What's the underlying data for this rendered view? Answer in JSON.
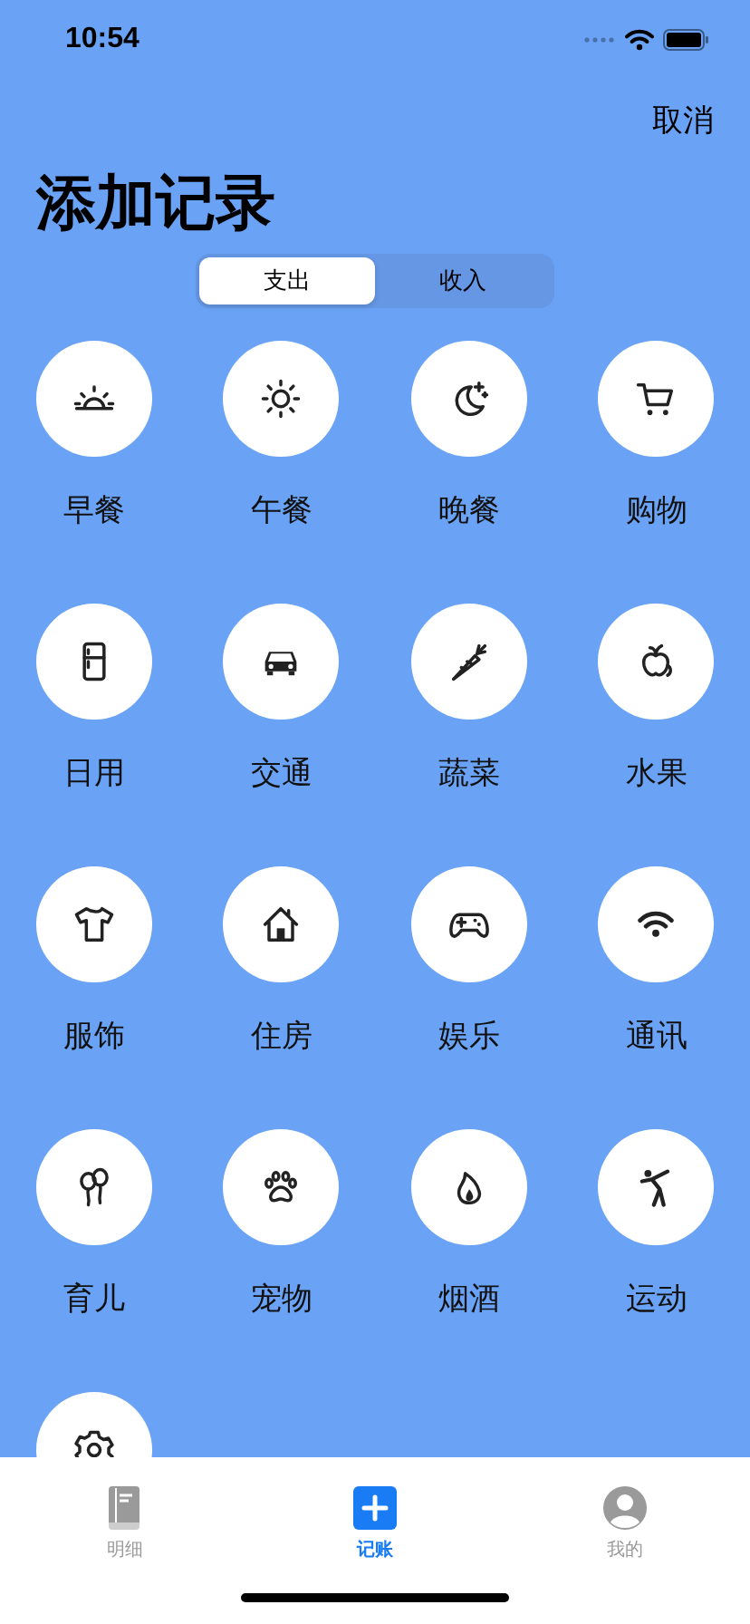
{
  "status_bar": {
    "time": "10:54"
  },
  "cancel": "取消",
  "title": "添加记录",
  "segments": [
    {
      "label": "支出",
      "selected": true
    },
    {
      "label": "收入",
      "selected": false
    }
  ],
  "categories": [
    {
      "kind": "labeled",
      "label": "早餐"
    },
    {
      "kind": "labeled",
      "label": "午餐"
    },
    {
      "kind": "labeled",
      "label": "晚餐"
    },
    {
      "kind": "labeled",
      "label": "购物"
    },
    {
      "kind": "labeled",
      "label": "日用"
    },
    {
      "kind": "labeled",
      "label": "交通"
    },
    {
      "kind": "labeled",
      "label": "蔬菜"
    },
    {
      "kind": "labeled",
      "label": "水果"
    },
    {
      "kind": "labeled",
      "label": "服饰"
    },
    {
      "kind": "labeled",
      "label": "住房"
    },
    {
      "kind": "labeled",
      "label": "娱乐"
    },
    {
      "kind": "labeled",
      "label": "通讯"
    },
    {
      "kind": "labeled",
      "label": "育儿"
    },
    {
      "kind": "labeled",
      "label": "宠物"
    },
    {
      "kind": "labeled",
      "label": "烟酒"
    },
    {
      "kind": "labeled",
      "label": "运动"
    },
    {
      "kind": "cut_off"
    }
  ],
  "tab_bar": [
    {
      "label": "明细",
      "selected": false
    },
    {
      "label": "记账",
      "selected": true
    },
    {
      "label": "我的",
      "selected": false
    }
  ]
}
